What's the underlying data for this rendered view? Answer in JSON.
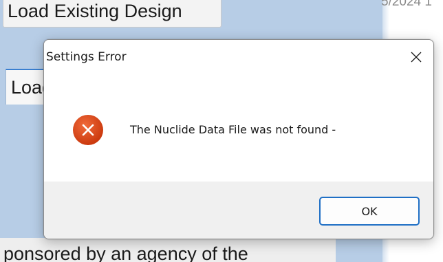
{
  "background": {
    "top_button_label": "Load Existing Design",
    "top_right_text": "5/2024 1",
    "mid_button_label": "Load",
    "bottom_text": "ponsored by an agency of the"
  },
  "dialog": {
    "title": "Settings Error",
    "message": "The Nuclide Data File was not found -",
    "ok_label": "OK",
    "icon": "error-icon",
    "icon_color": "#d83b01"
  },
  "colors": {
    "accent": "#1f6fc5",
    "background_app": "#b7cde6",
    "footer": "#f0f0f0"
  }
}
